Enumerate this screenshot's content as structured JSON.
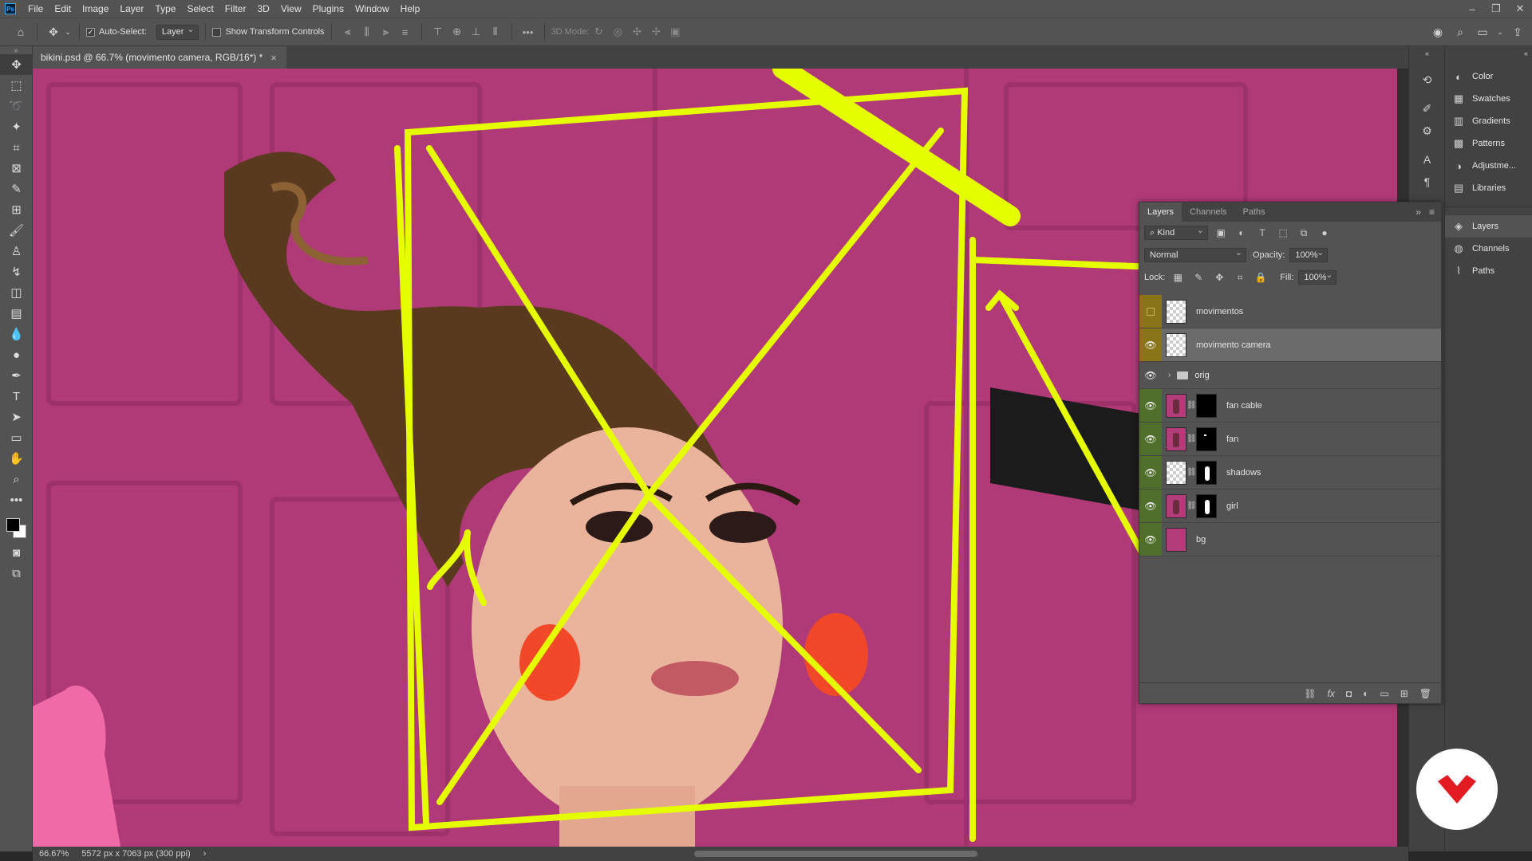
{
  "menubar": {
    "app_logo": "Ps",
    "items": [
      "File",
      "Edit",
      "Image",
      "Layer",
      "Type",
      "Select",
      "Filter",
      "3D",
      "View",
      "Plugins",
      "Window",
      "Help"
    ]
  },
  "options": {
    "auto_select_label": "Auto-Select:",
    "auto_select_target": "Layer",
    "show_transform_label": "Show Transform Controls",
    "mode_3d_label": "3D Mode:"
  },
  "document": {
    "tab_title": "bikini.psd @ 66.7% (movimento camera, RGB/16*) *"
  },
  "status": {
    "zoom": "66.67%",
    "doc_info": "5572 px x 7063 px (300 ppi)"
  },
  "dock": {
    "group1": [
      "Color",
      "Swatches",
      "Gradients",
      "Patterns",
      "Adjustme...",
      "Libraries"
    ],
    "group2": [
      "Layers",
      "Channels",
      "Paths"
    ]
  },
  "layers_panel": {
    "tabs": [
      "Layers",
      "Channels",
      "Paths"
    ],
    "filter_kind": "Kind",
    "blend_mode": "Normal",
    "opacity_label": "Opacity:",
    "opacity_value": "100%",
    "lock_label": "Lock:",
    "fill_label": "Fill:",
    "fill_value": "100%",
    "layers": [
      {
        "name": "movimentos"
      },
      {
        "name": "movimento camera"
      },
      {
        "name": "orig"
      },
      {
        "name": "fan cable"
      },
      {
        "name": "fan"
      },
      {
        "name": "shadows"
      },
      {
        "name": "girl"
      },
      {
        "name": "bg"
      }
    ]
  },
  "colors": {
    "canvas_bg": "#b33d7a",
    "annotation": "#e6ff00",
    "vis_yellow": "#8a7418",
    "vis_green": "#4f6f2a"
  }
}
